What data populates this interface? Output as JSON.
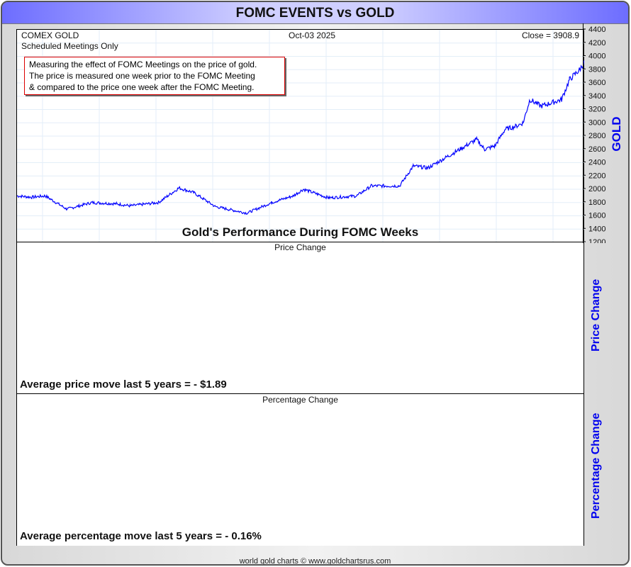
{
  "header": {
    "title": "FOMC EVENTS vs GOLD"
  },
  "info": {
    "instrument": "COMEX GOLD",
    "subtitle": "Scheduled Meetings Only",
    "date": "Oct-03  2025",
    "close": "Close = 3908.9"
  },
  "note": [
    "Measuring the effect of FOMC Meetings on the price of gold.",
    "The price is measured one week prior to the FOMC Meeting",
    "& compared to the price one week after the FOMC Meeting."
  ],
  "performance_title": "Gold's Performance During FOMC Weeks",
  "panels": {
    "price": {
      "title": "Price Change",
      "axis_label": "Price Change",
      "summary": "Average price move last 5 years = - $1.89"
    },
    "percent": {
      "title": "Percentage Change",
      "axis_label": "Percentage Change",
      "summary": "Average percentage move last 5 years = - 0.16%"
    }
  },
  "footer": "world gold charts © www.goldchartsrus.com",
  "chart_data": {
    "type": "line",
    "title": "FOMC EVENTS vs GOLD",
    "ylabel": "GOLD",
    "ylim": [
      1200,
      4400
    ],
    "yticks": [
      1200,
      1400,
      1600,
      1800,
      2000,
      2200,
      2400,
      2600,
      2800,
      3000,
      3200,
      3400,
      3600,
      3800,
      4000,
      4200,
      4400
    ],
    "xlim": [
      2020.75,
      2025.76
    ],
    "grid": true,
    "color": "#0000ff",
    "series": [
      {
        "name": "COMEX GOLD",
        "x": [
          2020.75,
          2020.88,
          2021.0,
          2021.19,
          2021.41,
          2021.63,
          2021.75,
          2022.0,
          2022.18,
          2022.31,
          2022.5,
          2022.78,
          2023.0,
          2023.19,
          2023.28,
          2023.5,
          2023.75,
          2023.88,
          2024.13,
          2024.25,
          2024.38,
          2024.56,
          2024.81,
          2024.88,
          2024.97,
          2025.06,
          2025.16,
          2025.22,
          2025.28,
          2025.38,
          2025.56,
          2025.63,
          2025.72,
          2025.76
        ],
        "y": [
          1900,
          1880,
          1900,
          1700,
          1800,
          1780,
          1750,
          1800,
          2020,
          1950,
          1740,
          1640,
          1800,
          1900,
          2000,
          1870,
          1900,
          2050,
          2050,
          2350,
          2320,
          2500,
          2750,
          2600,
          2650,
          2900,
          2950,
          3000,
          3350,
          3250,
          3350,
          3650,
          3800,
          3908.9
        ]
      }
    ]
  }
}
